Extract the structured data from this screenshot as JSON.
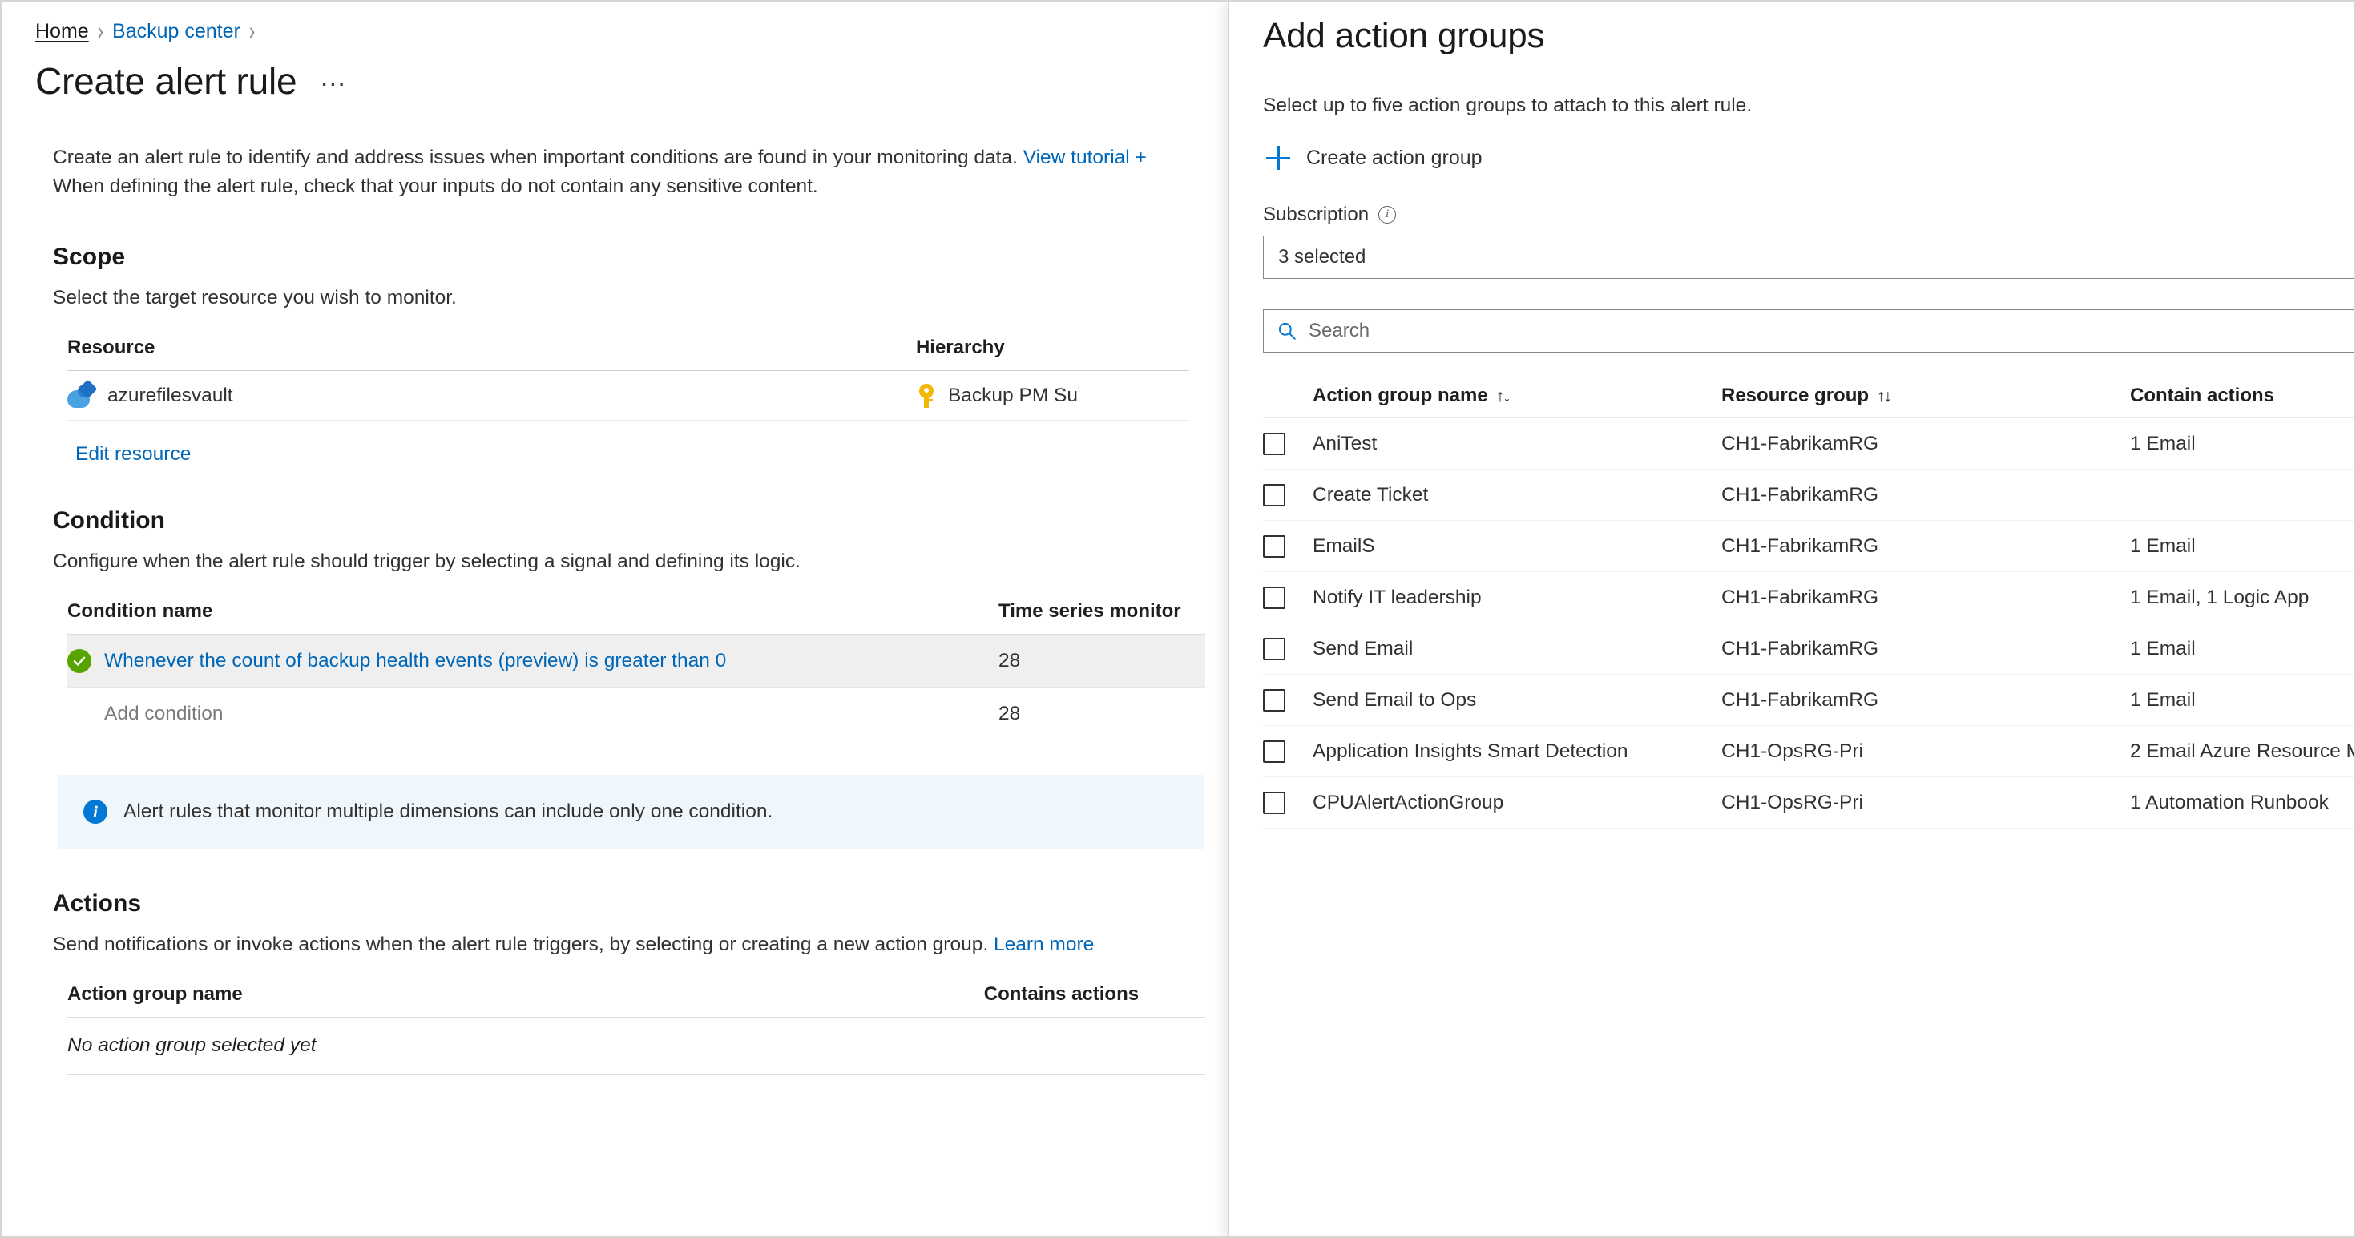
{
  "breadcrumb": {
    "home": "Home",
    "section": "Backup center",
    "sep": "›"
  },
  "page": {
    "title": "Create alert rule",
    "more_label": "…",
    "intro_line1": "Create an alert rule to identify and address issues when important conditions are found in your monitoring data. ",
    "intro_link": "View tutorial +",
    "intro_line2": "When defining the alert rule, check that your inputs do not contain any sensitive content."
  },
  "scope": {
    "heading": "Scope",
    "description": "Select the target resource you wish to monitor.",
    "columns": {
      "resource": "Resource",
      "hierarchy": "Hierarchy"
    },
    "row": {
      "resource": "azurefilesvault",
      "hierarchy": "Backup PM Su"
    },
    "edit_link": "Edit resource"
  },
  "condition": {
    "heading": "Condition",
    "description": "Configure when the alert rule should trigger by selecting a signal and defining its logic.",
    "columns": {
      "name": "Condition name",
      "time_series": "Time series monitor"
    },
    "rows": [
      {
        "name": "Whenever the count of backup health events (preview) is greater than 0",
        "time_series": "28",
        "status": "ok",
        "selected": true
      },
      {
        "name": "Add condition",
        "time_series": "28",
        "status": "none",
        "selected": false
      }
    ],
    "info_banner": "Alert rules that monitor multiple dimensions can include only one condition."
  },
  "actions": {
    "heading": "Actions",
    "description": "Send notifications or invoke actions when the alert rule triggers, by selecting or creating a new action group. ",
    "learn_more": "Learn more",
    "columns": {
      "name": "Action group name",
      "contains": "Contains actions"
    },
    "empty_text": "No action group selected yet"
  },
  "panel": {
    "title": "Add action groups",
    "description": "Select up to five action groups to attach to this alert rule.",
    "create_label": "Create action group",
    "subscription_label": "Subscription",
    "subscription_value": "3 selected",
    "search_placeholder": "Search",
    "columns": {
      "name": "Action group name",
      "resource_group": "Resource group",
      "contains": "Contain actions",
      "sort_glyph": "↑↓"
    },
    "rows": [
      {
        "name": "AniTest",
        "resource_group": "CH1-FabrikamRG",
        "contains": "1 Email",
        "checked": false
      },
      {
        "name": "Create Ticket",
        "resource_group": "CH1-FabrikamRG",
        "contains": "",
        "checked": false
      },
      {
        "name": "EmailS",
        "resource_group": "CH1-FabrikamRG",
        "contains": "1 Email",
        "checked": false
      },
      {
        "name": "Notify IT leadership",
        "resource_group": "CH1-FabrikamRG",
        "contains": "1 Email, 1 Logic App",
        "checked": false
      },
      {
        "name": "Send Email",
        "resource_group": "CH1-FabrikamRG",
        "contains": "1 Email",
        "checked": false
      },
      {
        "name": "Send Email to Ops",
        "resource_group": "CH1-FabrikamRG",
        "contains": "1 Email",
        "checked": false
      },
      {
        "name": "Application Insights Smart Detection",
        "resource_group": "CH1-OpsRG-Pri",
        "contains": "2 Email Azure Resource M",
        "checked": false
      },
      {
        "name": "CPUAlertActionGroup",
        "resource_group": "CH1-OpsRG-Pri",
        "contains": "1 Automation Runbook",
        "checked": false
      }
    ]
  },
  "colors": {
    "accent": "#0067b8",
    "link": "#0078d4",
    "success": "#57a300",
    "info_bg": "#eff6fc",
    "key": "#f2b705"
  }
}
